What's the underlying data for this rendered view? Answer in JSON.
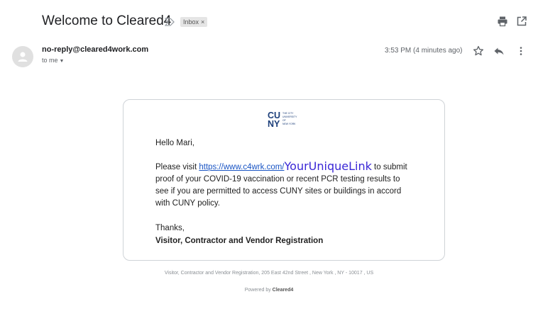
{
  "email": {
    "subject": "Welcome to Cleared4",
    "label": "Inbox",
    "label_close": "×",
    "sender": "no-reply@cleared4work.com",
    "recipient": "to me",
    "time": "3:53 PM (4 minutes ago)"
  },
  "body": {
    "greeting": "Hello Mari,",
    "line1_prefix": "Please visit ",
    "link": "https://www.c4wrk.com/",
    "placeholder": "YourUniqueLink",
    "line1_suffix": " to submit",
    "line2": "proof of your COVID-19 vaccination or recent PCR testing results to",
    "line3": "see if you are permitted to access CUNY sites or buildings in accord",
    "line4": "with CUNY policy.",
    "thanks": "Thanks,",
    "signature": "Visitor, Contractor and Vendor Registration"
  },
  "logo": {
    "mark_top": "CU",
    "mark_bottom": "NY",
    "text_lines": [
      "THE CITY",
      "UNIVERSITY",
      "OF",
      "NEW YORK"
    ],
    "color": "#1d3f7a"
  },
  "footer": {
    "address": "Visitor, Contractor and Vendor Registration, 205 East 42nd Street , New York , NY - 10017 , US",
    "powered_prefix": "Powered by ",
    "powered_brand": "Cleared4"
  },
  "icons": {
    "important": "important-marker-icon",
    "print": "print-icon",
    "new_window": "open-in-new-window-icon",
    "star": "star-icon",
    "reply": "reply-icon",
    "more": "more-vertical-icon",
    "avatar": "avatar-person-icon"
  }
}
